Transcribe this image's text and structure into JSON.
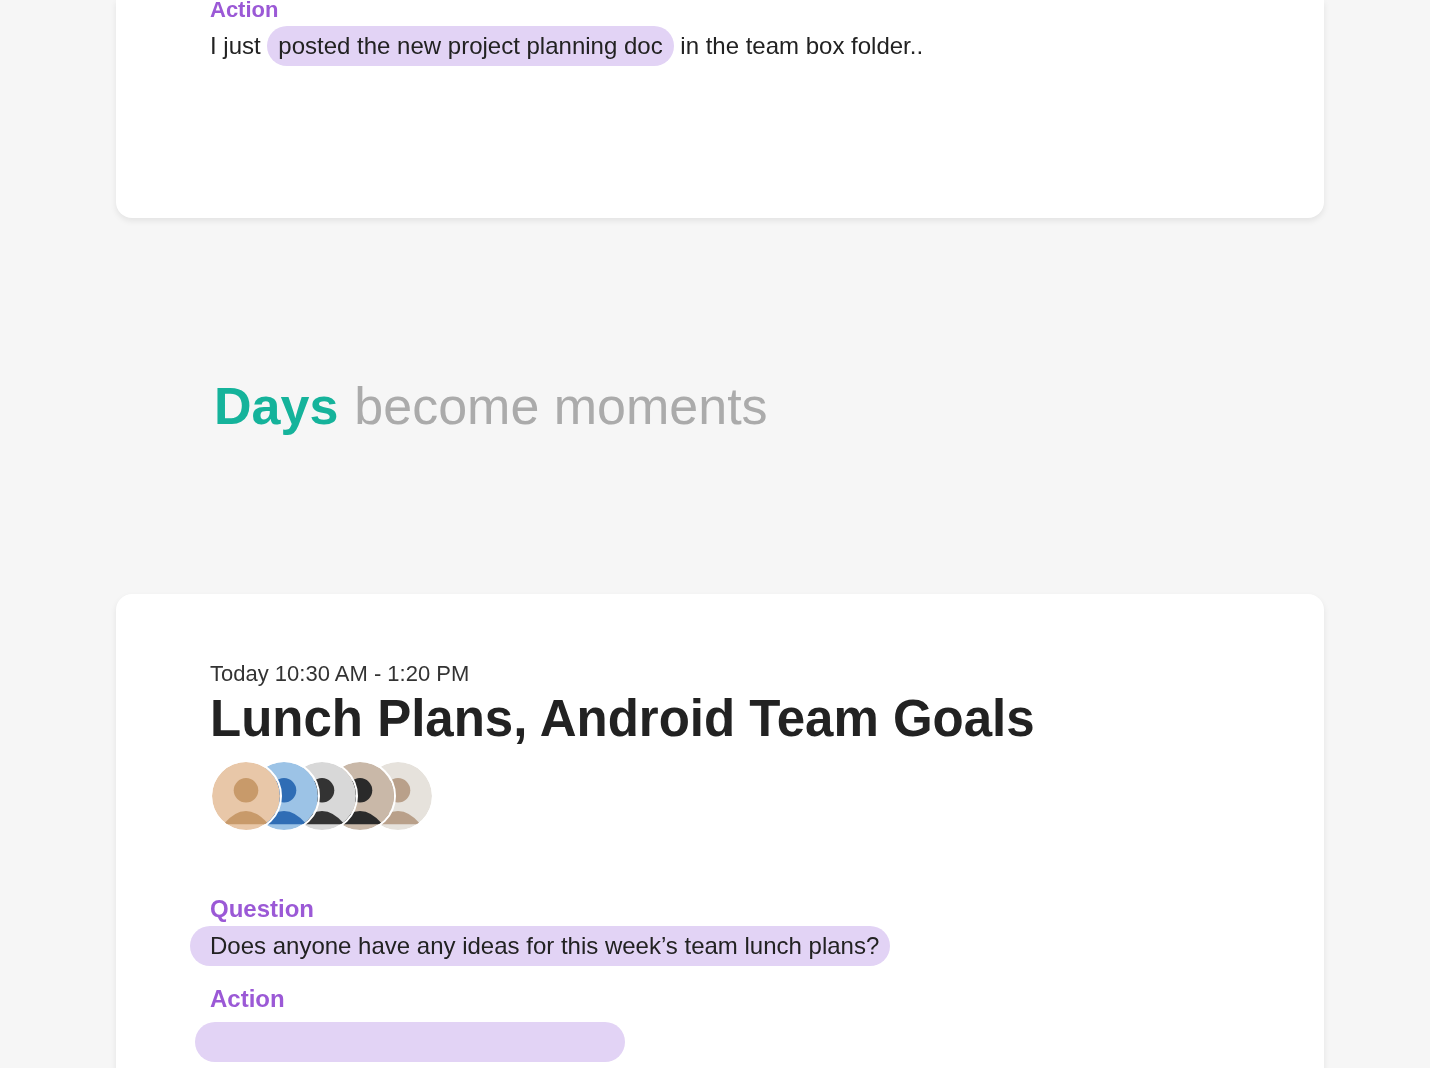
{
  "cards": [
    {
      "items": [
        {
          "kind": "text",
          "label": "Action",
          "parts": [
            {
              "text": "I just",
              "highlight": false
            },
            {
              "text": "posted the new project planning doc",
              "highlight": true
            },
            {
              "text": "in the team box folder..",
              "highlight": false
            }
          ]
        }
      ]
    },
    {
      "time": "Today 10:30 AM - 1:20 PM",
      "title": "Lunch Plans, Android Team Goals",
      "attendees": [
        {
          "kind": "avatar"
        },
        {
          "kind": "avatar"
        },
        {
          "kind": "avatar"
        },
        {
          "kind": "avatar"
        },
        {
          "kind": "avatar"
        }
      ],
      "items": [
        {
          "kind": "text",
          "label": "Question",
          "parts": [
            {
              "text": "Does anyone have any ideas for this week’s team lunch plans?",
              "highlight": true
            }
          ]
        },
        {
          "kind": "clipped",
          "label": "Action"
        }
      ]
    }
  ],
  "headline": {
    "strong": "Days",
    "rest": "become moments"
  }
}
